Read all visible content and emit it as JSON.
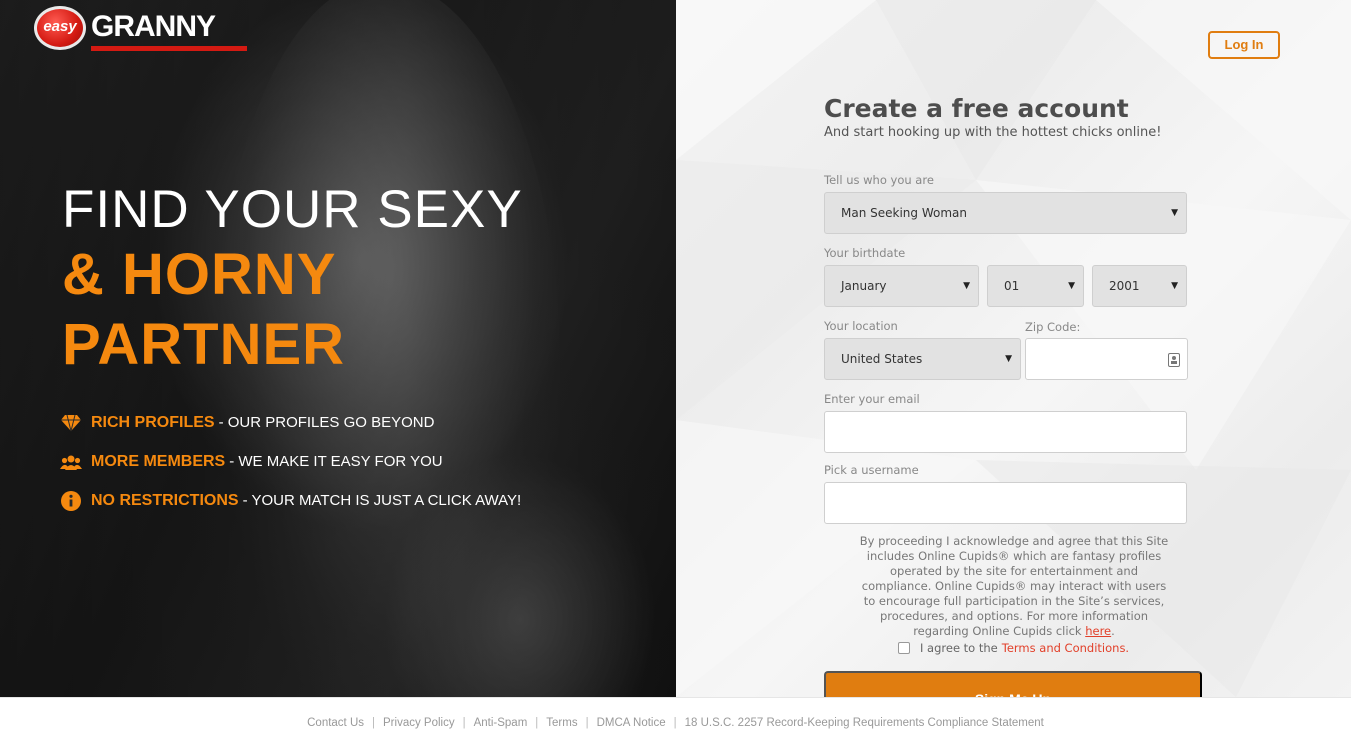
{
  "brand": {
    "badge": "easy",
    "name": "GRANNY",
    "accent": "#d41a12"
  },
  "hero": {
    "line1": "FIND YOUR SEXY",
    "line2": "& HORNY",
    "line3": "PARTNER",
    "accent_color": "#f5890f",
    "features": [
      {
        "icon": "diamond-icon",
        "key": "RICH PROFILES",
        "rest": "- OUR PROFILES GO BEYOND"
      },
      {
        "icon": "group-icon",
        "key": "MORE MEMBERS",
        "rest": "- WE MAKE IT EASY FOR YOU"
      },
      {
        "icon": "info-icon",
        "key": "NO RESTRICTIONS",
        "rest": "- YOUR MATCH IS JUST A CLICK AWAY!"
      }
    ]
  },
  "header": {
    "login_label": "Log In"
  },
  "form": {
    "title": "Create a free account",
    "subtitle": "And start hooking up with the hottest chicks online!",
    "who_label": "Tell us who you are",
    "who_value": "Man Seeking Woman",
    "birthdate_label": "Your birthdate",
    "month_value": "January",
    "day_value": "01",
    "year_value": "2001",
    "location_label": "Your location",
    "location_value": "United States",
    "zip_label": "Zip Code:",
    "zip_value": "",
    "email_label": "Enter your email",
    "email_value": "",
    "username_label": "Pick a username",
    "username_value": "",
    "legal_text": "By proceeding I acknowledge and agree that this Site includes Online Cupids® which are fantasy profiles operated by the site for entertainment and compliance. Online Cupids® may interact with users to encourage full participation in the Site’s services, procedures, and options. For more information regarding Online Cupids click",
    "legal_link": "here",
    "agree_text": "I agree to the",
    "terms_link": "Terms and Conditions.",
    "signup_label": "Sign Me Up",
    "button_color": "#e07d10"
  },
  "footer": {
    "links": [
      "Contact Us",
      "Privacy Policy",
      "Anti-Spam",
      "Terms",
      "DMCA Notice",
      "18 U.S.C. 2257 Record-Keeping Requirements Compliance Statement"
    ]
  }
}
